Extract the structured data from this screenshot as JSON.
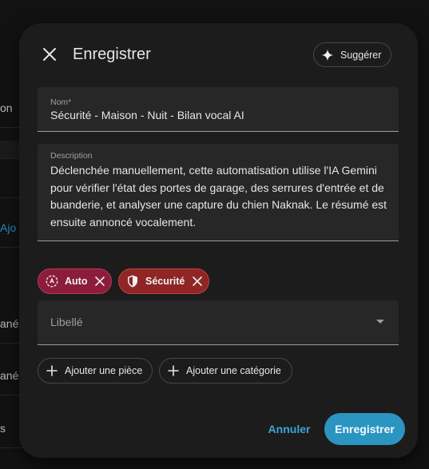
{
  "background": {
    "rows": [
      "on",
      "",
      "Ajo",
      "ané",
      "ané",
      "s"
    ]
  },
  "dialog": {
    "title": "Enregistrer",
    "suggest_label": "Suggérer"
  },
  "name_field": {
    "label": "Nom*",
    "value": "Sécurité - Maison - Nuit - Bilan vocal AI"
  },
  "description_field": {
    "label": "Description",
    "value": "Déclenchée manuellement, cette automatisation utilise l'IA Gemini pour vérifier l'état des portes de garage, des serrures d'entrée et de buanderie, et analyser une capture du chien Naknak. Le résumé est ensuite annoncé vocalement."
  },
  "chips": [
    {
      "label": "Auto",
      "icon": "robot-icon",
      "color": "#8b1d3a"
    },
    {
      "label": "Sécurité",
      "icon": "shield-icon",
      "color": "#8f2525"
    }
  ],
  "label_select": {
    "placeholder": "Libellé"
  },
  "add_buttons": {
    "room": "Ajouter une pièce",
    "category": "Ajouter une catégorie"
  },
  "actions": {
    "cancel": "Annuler",
    "save": "Enregistrer"
  },
  "colors": {
    "accent": "#2b95c2",
    "link": "#3ba5d6"
  }
}
